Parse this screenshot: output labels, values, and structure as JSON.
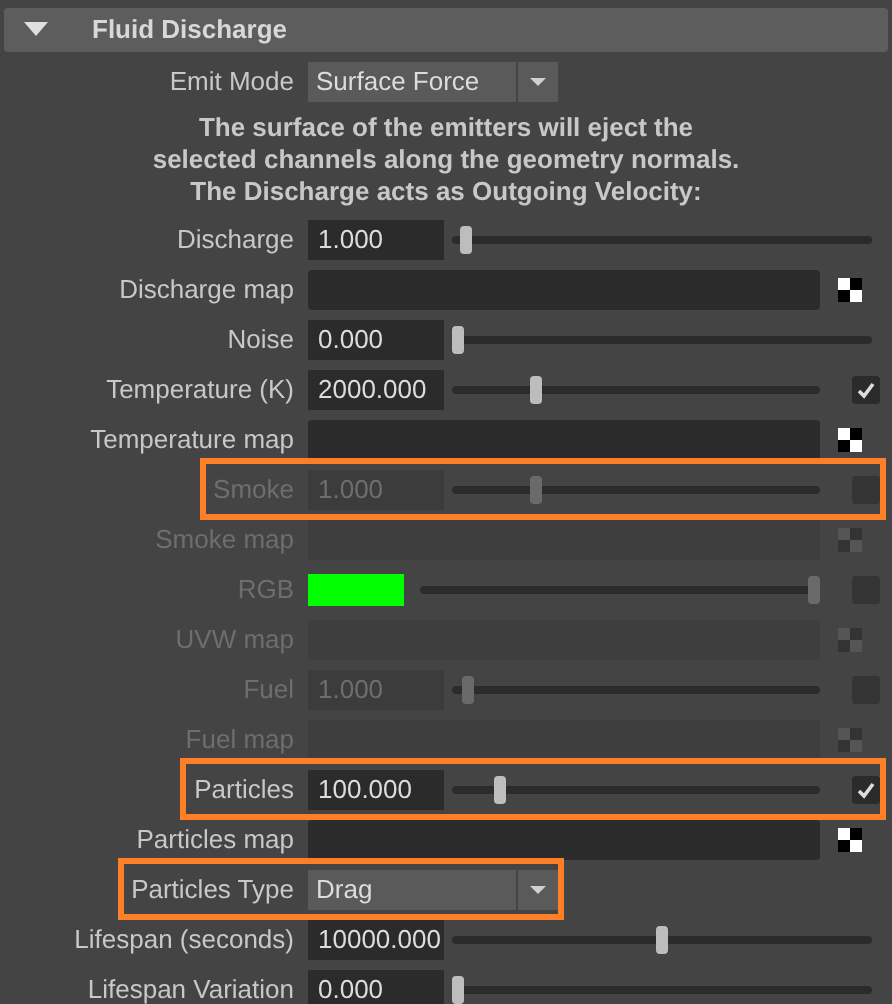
{
  "section": {
    "title": "Fluid Discharge",
    "expanded": true
  },
  "rows": [
    {
      "kind": "dropdown",
      "label": "Emit Mode",
      "value": "Surface Force",
      "disabled": false,
      "highlighted": false
    },
    {
      "kind": "note",
      "lines": [
        "The surface of the emitters will eject the",
        "selected channels along the geometry normals.",
        "The Discharge acts as Outgoing Velocity:"
      ]
    },
    {
      "kind": "slider",
      "label": "Discharge",
      "value": "1.000",
      "level": 0.02,
      "disabled": false,
      "highlighted": false
    },
    {
      "kind": "map",
      "label": "Discharge map",
      "disabled": false,
      "highlighted": false
    },
    {
      "kind": "slider",
      "label": "Noise",
      "value": "0.000",
      "level": 0.0,
      "disabled": false,
      "highlighted": false
    },
    {
      "kind": "slider",
      "label": "Temperature (K)",
      "value": "2000.000",
      "level": 0.22,
      "checked": true,
      "disabled": false,
      "highlighted": false
    },
    {
      "kind": "map",
      "label": "Temperature map",
      "disabled": false,
      "highlighted": false
    },
    {
      "kind": "slider",
      "label": "Smoke",
      "value": "1.000",
      "level": 0.22,
      "checked": false,
      "disabled": true,
      "highlighted": true
    },
    {
      "kind": "map",
      "label": "Smoke map",
      "disabled": true,
      "highlighted": false
    },
    {
      "kind": "color",
      "label": "RGB",
      "color": "#00ff00",
      "level": 1.0,
      "checked": false,
      "disabled": true,
      "highlighted": false
    },
    {
      "kind": "map",
      "label": "UVW map",
      "disabled": true,
      "highlighted": false
    },
    {
      "kind": "slider",
      "label": "Fuel",
      "value": "1.000",
      "level": 0.03,
      "checked": false,
      "disabled": true,
      "highlighted": false
    },
    {
      "kind": "map",
      "label": "Fuel map",
      "disabled": true,
      "highlighted": false
    },
    {
      "kind": "slider",
      "label": "Particles",
      "value": "100.000",
      "level": 0.12,
      "checked": true,
      "disabled": false,
      "highlighted": true
    },
    {
      "kind": "map",
      "label": "Particles map",
      "disabled": false,
      "highlighted": false
    },
    {
      "kind": "dropdown",
      "label": "Particles Type",
      "value": "Drag",
      "disabled": false,
      "highlighted": true
    },
    {
      "kind": "slider",
      "label": "Lifespan (seconds)",
      "value": "10000.000",
      "level": 0.5,
      "disabled": false,
      "highlighted": false
    },
    {
      "kind": "slider",
      "label": "Lifespan Variation",
      "value": "0.000",
      "level": 0.0,
      "disabled": false,
      "highlighted": false
    }
  ]
}
